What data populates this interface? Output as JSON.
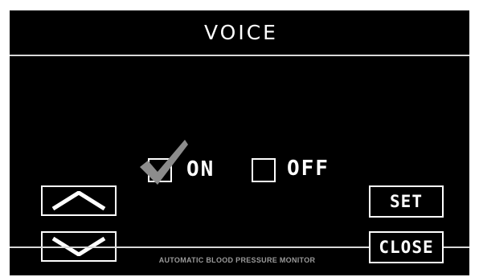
{
  "screen": {
    "title": "VOICE",
    "footer": "AUTOMATIC BLOOD PRESSURE MONITOR"
  },
  "options": {
    "on": {
      "label": "ON",
      "checked": true
    },
    "off": {
      "label": "OFF",
      "checked": false
    }
  },
  "buttons": {
    "set_label": "SET",
    "close_label": "CLOSE",
    "up_icon": "chevron-up-icon",
    "down_icon": "chevron-down-icon"
  },
  "colors": {
    "background": "#000000",
    "foreground": "#ffffff",
    "check_mark": "#8c8c8c",
    "footer_text": "#9a9a9a"
  }
}
